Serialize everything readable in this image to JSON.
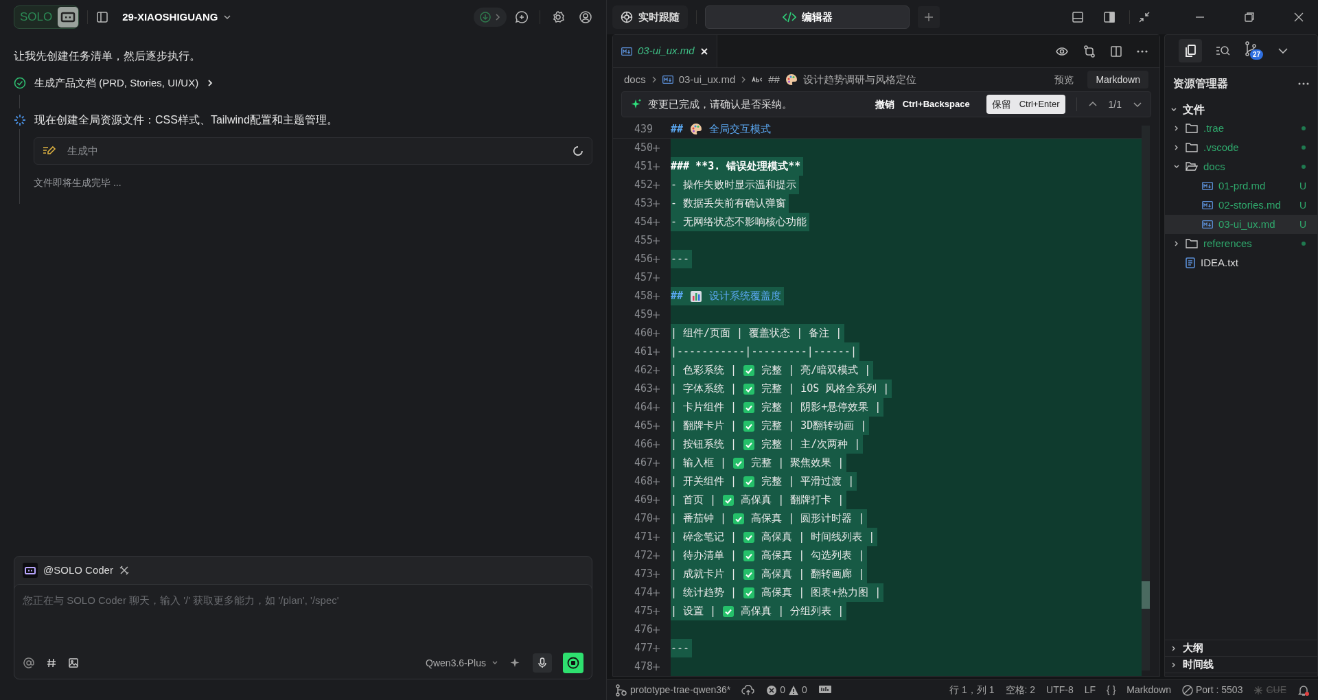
{
  "app": {
    "logo": "SOLO",
    "project": "29-XIAOSHIGUANG"
  },
  "chat": {
    "messages": [
      {
        "kind": "text",
        "text": "让我先创建任务清单，然后逐步执行。"
      },
      {
        "kind": "task_done",
        "text": "生成产品文档 (PRD, Stories, UI/UX)"
      },
      {
        "kind": "task_running",
        "text": "现在创建全局资源文件：CSS样式、Tailwind配置和主题管理。",
        "tool": "生成中",
        "note": "文件即将生成完毕 ..."
      }
    ]
  },
  "composer": {
    "agent": "@SOLO Coder",
    "placeholder": "您正在与 SOLO Coder 聊天，输入 '/' 获取更多能力，如 '/plan', '/spec'",
    "model": "Qwen3.6-Plus"
  },
  "view_tabs": [
    {
      "label": "实时跟随",
      "selected": false
    },
    {
      "label": "编辑器",
      "selected": true
    }
  ],
  "editor": {
    "tabs": [
      {
        "label": "03-ui_ux.md",
        "selected": true
      }
    ],
    "breadcrumb": {
      "folder": "docs",
      "file": "03-ui_ux.md",
      "marker": "##",
      "section": "设计趋势调研与风格定位"
    },
    "preview": "预览",
    "language": "Markdown",
    "banner": {
      "message": "变更已完成，请确认是否采纳。",
      "undo": "撤销",
      "undo_key": "Ctrl+Backspace",
      "keep": "保留",
      "keep_key": "Ctrl+Enter",
      "counter": "1/1"
    },
    "lines": [
      {
        "number": "439",
        "added": false,
        "kind": "heading-palette",
        "marker": "##",
        "text": "全局交互模式"
      },
      {
        "number": "450",
        "added": true,
        "kind": "blank"
      },
      {
        "number": "451",
        "added": true,
        "kind": "plain",
        "text": "### **3. 错误处理模式**"
      },
      {
        "number": "452",
        "added": true,
        "kind": "plain",
        "text": "- 操作失败时显示温和提示"
      },
      {
        "number": "453",
        "added": true,
        "kind": "plain",
        "text": "- 数据丢失前有确认弹窗"
      },
      {
        "number": "454",
        "added": true,
        "kind": "plain",
        "text": "- 无网络状态不影响核心功能"
      },
      {
        "number": "455",
        "added": true,
        "kind": "blank"
      },
      {
        "number": "456",
        "added": true,
        "kind": "plain",
        "text": "---"
      },
      {
        "number": "457",
        "added": true,
        "kind": "blank"
      },
      {
        "number": "458",
        "added": true,
        "kind": "heading-chart",
        "marker": "##",
        "text": "设计系统覆盖度"
      },
      {
        "number": "459",
        "added": true,
        "kind": "blank"
      },
      {
        "number": "460",
        "added": true,
        "kind": "plain",
        "text": "| 组件/页面 | 覆盖状态 | 备注 |"
      },
      {
        "number": "461",
        "added": true,
        "kind": "plain",
        "text": "|-----------|---------|------|"
      },
      {
        "number": "462",
        "added": true,
        "kind": "check",
        "before": "| 色彩系统 |",
        "after": "完整 | 亮/暗双模式 |"
      },
      {
        "number": "463",
        "added": true,
        "kind": "check",
        "before": "| 字体系统 |",
        "after": "完整 | iOS 风格全系列 |"
      },
      {
        "number": "464",
        "added": true,
        "kind": "check",
        "before": "| 卡片组件 |",
        "after": "完整 | 阴影+悬停效果 |"
      },
      {
        "number": "465",
        "added": true,
        "kind": "check",
        "before": "| 翻牌卡片 |",
        "after": "完整 | 3D翻转动画 |"
      },
      {
        "number": "466",
        "added": true,
        "kind": "check",
        "before": "| 按钮系统 |",
        "after": "完整 | 主/次两种 |"
      },
      {
        "number": "467",
        "added": true,
        "kind": "check",
        "before": "| 输入框 |",
        "after": "完整 | 聚焦效果 |"
      },
      {
        "number": "468",
        "added": true,
        "kind": "check",
        "before": "| 开关组件 |",
        "after": "完整 | 平滑过渡 |"
      },
      {
        "number": "469",
        "added": true,
        "kind": "check",
        "before": "| 首页 |",
        "after": "高保真 | 翻牌打卡 |"
      },
      {
        "number": "470",
        "added": true,
        "kind": "check",
        "before": "| 番茄钟 |",
        "after": "高保真 | 圆形计时器 |"
      },
      {
        "number": "471",
        "added": true,
        "kind": "check",
        "before": "| 碎念笔记 |",
        "after": "高保真 | 时间线列表 |"
      },
      {
        "number": "472",
        "added": true,
        "kind": "check",
        "before": "| 待办清单 |",
        "after": "高保真 | 勾选列表 |"
      },
      {
        "number": "473",
        "added": true,
        "kind": "check",
        "before": "| 成就卡片 |",
        "after": "高保真 | 翻转画廊 |"
      },
      {
        "number": "474",
        "added": true,
        "kind": "check",
        "before": "| 统计趋势 |",
        "after": "高保真 | 图表+热力图 |"
      },
      {
        "number": "475",
        "added": true,
        "kind": "check",
        "before": "| 设置 |",
        "after": "高保真 | 分组列表 |"
      },
      {
        "number": "476",
        "added": true,
        "kind": "blank"
      },
      {
        "number": "477",
        "added": true,
        "kind": "plain",
        "text": "---"
      },
      {
        "number": "478",
        "added": true,
        "kind": "blank"
      }
    ]
  },
  "explorer": {
    "title": "资源管理器",
    "section": "文件",
    "badge": "27",
    "tree": [
      {
        "name": ".trae",
        "kind": "folder",
        "expanded": false,
        "untracked": true,
        "selected": false
      },
      {
        "name": ".vscode",
        "kind": "folder",
        "expanded": false,
        "untracked": true,
        "selected": false
      },
      {
        "name": "docs",
        "kind": "folder",
        "expanded": true,
        "untracked": true,
        "selected": false,
        "children": [
          {
            "name": "01-prd.md",
            "kind": "markdown",
            "untracked": true,
            "status": "U",
            "selected": false
          },
          {
            "name": "02-stories.md",
            "kind": "markdown",
            "untracked": true,
            "status": "U",
            "selected": false
          },
          {
            "name": "03-ui_ux.md",
            "kind": "markdown",
            "untracked": true,
            "status": "U",
            "selected": true
          }
        ]
      },
      {
        "name": "references",
        "kind": "folder",
        "expanded": false,
        "untracked": true,
        "selected": false
      },
      {
        "name": "IDEA.txt",
        "kind": "text",
        "untracked": false,
        "selected": false
      }
    ],
    "panels": [
      "大纲",
      "时间线"
    ]
  },
  "status_bar": {
    "branch": "prototype-trae-qwen36*",
    "errors": "0",
    "warnings": "0",
    "position": "行 1，列 1",
    "indent": "空格: 2",
    "encoding": "UTF-8",
    "eol": "LF",
    "braces": "{ }",
    "language": "Markdown",
    "port": "Port : 5503",
    "cue": "CUE"
  }
}
